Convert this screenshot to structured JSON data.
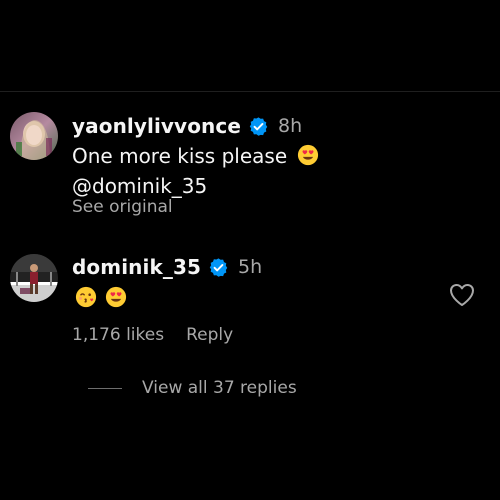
{
  "comments": [
    {
      "username": "yaonlylivvonce",
      "time": "8h",
      "text_line1": "One more kiss please",
      "text_line2": "@dominik_35",
      "see_original": "See original",
      "emojis": [
        "heart-eyes-emoji"
      ]
    },
    {
      "username": "dominik_35",
      "time": "5h",
      "emojis": [
        "kissing-face-emoji",
        "heart-eyes-emoji"
      ],
      "likes": "1,176 likes",
      "reply_label": "Reply",
      "view_replies": "View all 37 replies"
    }
  ],
  "colors": {
    "background": "#000000",
    "primary_text": "#f5f5f5",
    "secondary_text": "#a8a8a8",
    "verified_badge": "#0095f6"
  },
  "icons": [
    "verified-badge-icon",
    "heart-outline-icon"
  ]
}
